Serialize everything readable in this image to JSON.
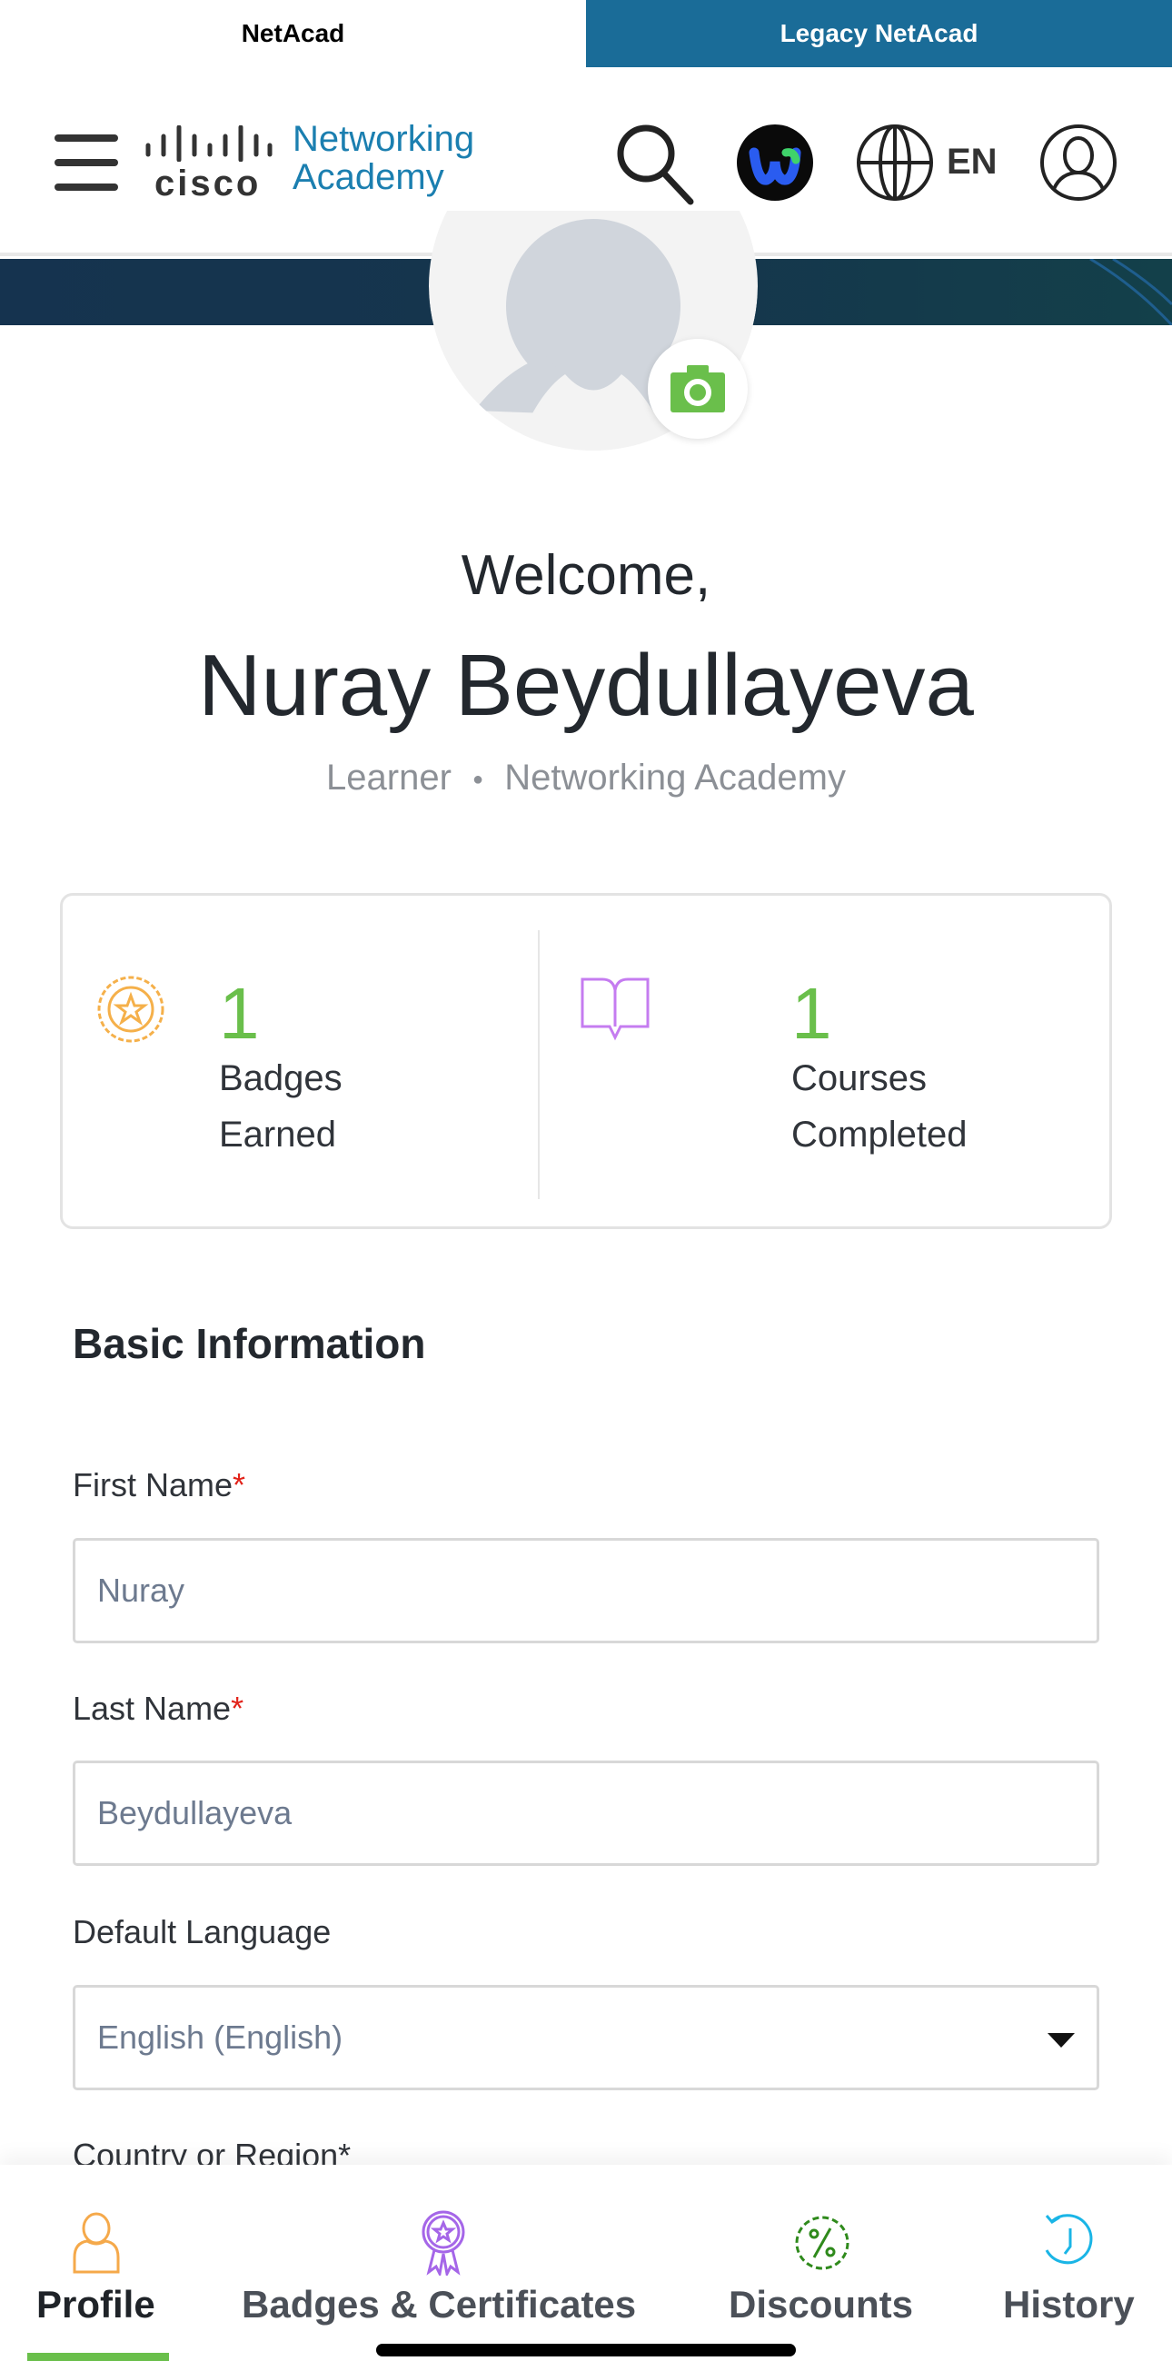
{
  "top_tabs": {
    "netacad": "NetAcad",
    "legacy": "Legacy NetAcad"
  },
  "header": {
    "logo_wordmark": "cisco",
    "logo_line1": "Networking",
    "logo_line2": "Academy",
    "language": "EN",
    "icons": [
      "menu-icon",
      "search-icon",
      "webex-icon",
      "globe-icon",
      "user-icon"
    ]
  },
  "profile": {
    "welcome": "Welcome,",
    "name": "Nuray Beydullayeva",
    "role": "Learner",
    "org": "Networking Academy",
    "separator": "●"
  },
  "stats": [
    {
      "value": "1",
      "line1": "Badges",
      "line2": "Earned",
      "icon": "badge-icon",
      "icon_color": "#f5b04a"
    },
    {
      "value": "1",
      "line1": "Courses",
      "line2": "Completed",
      "icon": "book-icon",
      "icon_color": "#c57cf0"
    }
  ],
  "form": {
    "section_title": "Basic Information",
    "required_mark": "*",
    "first_name": {
      "label": "First Name",
      "value": "Nuray"
    },
    "last_name": {
      "label": "Last Name",
      "value": "Beydullayeva"
    },
    "default_language": {
      "label": "Default Language",
      "value": "English (English)"
    },
    "country": {
      "label": "Country or Region*"
    }
  },
  "bottom_nav": [
    {
      "label": "Profile",
      "color": "#f5a94a",
      "active": true
    },
    {
      "label": "Badges & Certificates",
      "color": "#a566e8"
    },
    {
      "label": "Discounts",
      "color": "#2f8a1c"
    },
    {
      "label": "History",
      "color": "#1ab5e6"
    }
  ],
  "colors": {
    "accent_green": "#6abf4b",
    "legacy_tab": "#1a6c98",
    "logo_blue": "#1b7fb0"
  }
}
